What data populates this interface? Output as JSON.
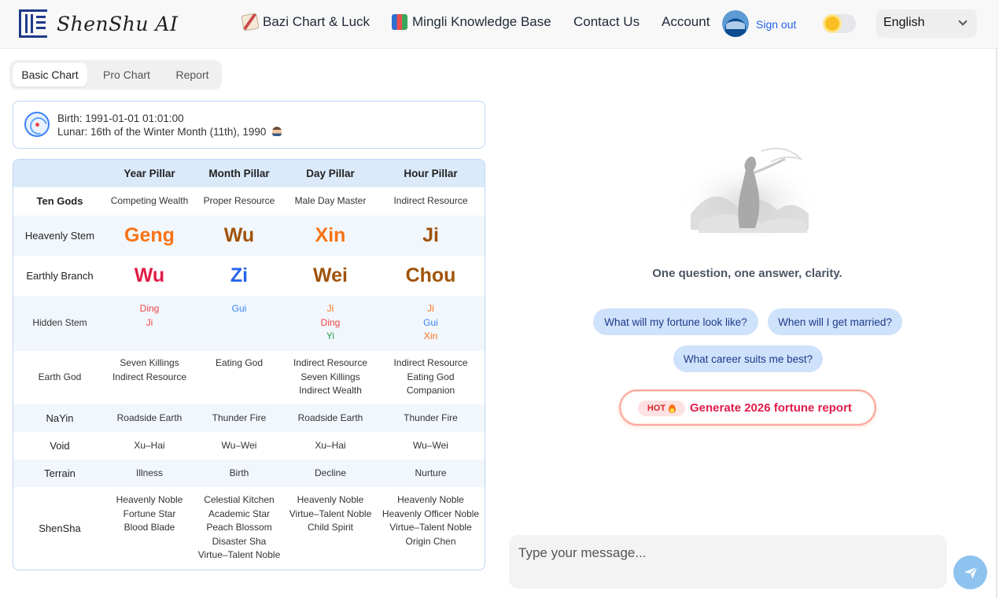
{
  "brand": {
    "name": "ShenShu AI"
  },
  "nav": {
    "bazi": {
      "label": "Bazi Chart & Luck",
      "icon": "pencil-icon"
    },
    "mingli": {
      "label": "Mingli Knowledge Base",
      "icon": "books-icon"
    },
    "contact": "Contact Us",
    "account": "Account",
    "signout": "Sign out",
    "language": "English"
  },
  "tabs": [
    {
      "label": "Basic Chart",
      "active": true
    },
    {
      "label": "Pro Chart",
      "active": false
    },
    {
      "label": "Report",
      "active": false
    }
  ],
  "birth": {
    "line1": "Birth: 1991-01-01 01:01:00",
    "line2": "Lunar: 16th of the Winter Month (11th), 1990"
  },
  "table": {
    "headers": [
      "",
      "Year Pillar",
      "Month Pillar",
      "Day Pillar",
      "Hour Pillar"
    ],
    "ten_gods": {
      "label": "Ten Gods",
      "values": [
        "Competing Wealth",
        "Proper Resource",
        "Male Day Master",
        "Indirect Resource"
      ]
    },
    "heavenly_stem": {
      "label": "Heavenly Stem",
      "values": [
        "Geng",
        "Wu",
        "Xin",
        "Ji"
      ]
    },
    "earthly_branch": {
      "label": "Earthly Branch",
      "values": [
        "Wu",
        "Zi",
        "Wei",
        "Chou"
      ]
    },
    "hidden_stem": {
      "label": "Hidden Stem",
      "values": [
        [
          "Ding",
          "Ji"
        ],
        [
          "Gui"
        ],
        [
          "Ji",
          "Ding",
          "Yi"
        ],
        [
          "Ji",
          "Gui",
          "Xin"
        ]
      ]
    },
    "earth_god": {
      "label": "Earth God",
      "values": [
        [
          "Seven Killings",
          "Indirect Resource"
        ],
        [
          "Eating God"
        ],
        [
          "Indirect Resource",
          "Seven Killings",
          "Indirect Wealth"
        ],
        [
          "Indirect Resource",
          "Eating God",
          "Companion"
        ]
      ]
    },
    "nayin": {
      "label": "NaYin",
      "values": [
        "Roadside Earth",
        "Thunder Fire",
        "Roadside Earth",
        "Thunder Fire"
      ]
    },
    "void": {
      "label": "Void",
      "values": [
        "Xu–Hai",
        "Wu–Wei",
        "Xu–Hai",
        "Wu–Wei"
      ]
    },
    "terrain": {
      "label": "Terrain",
      "values": [
        "Illness",
        "Birth",
        "Decline",
        "Nurture"
      ]
    },
    "shensha": {
      "label": "ShenSha",
      "values": [
        [
          "Heavenly Noble",
          "Fortune Star",
          "Blood Blade"
        ],
        [
          "Celestial Kitchen",
          "Academic Star",
          "Peach Blossom",
          "Disaster Sha",
          "Virtue–Talent Noble"
        ],
        [
          "Heavenly Noble",
          "Virtue–Talent Noble",
          "Child Spirit"
        ],
        [
          "Heavenly Noble",
          "Heavenly Officer Noble",
          "Virtue–Talent Noble",
          "Origin Chen"
        ]
      ]
    }
  },
  "chat": {
    "tagline": "One question, one answer, clarity.",
    "suggestions": [
      "What will my fortune look like?",
      "When will I get married?",
      "What career suits me best?"
    ],
    "hot_badge": "HOT",
    "hot_label": "Generate 2026 fortune report",
    "input_placeholder": "Type your message..."
  },
  "colors": {
    "accent_blue": "#2563eb",
    "chip_bg": "#cfe2fb",
    "table_header_bg": "#dbeafb",
    "stem_orange": "#f97316",
    "stem_brown": "#a0530a",
    "branch_red": "#e11d48"
  }
}
